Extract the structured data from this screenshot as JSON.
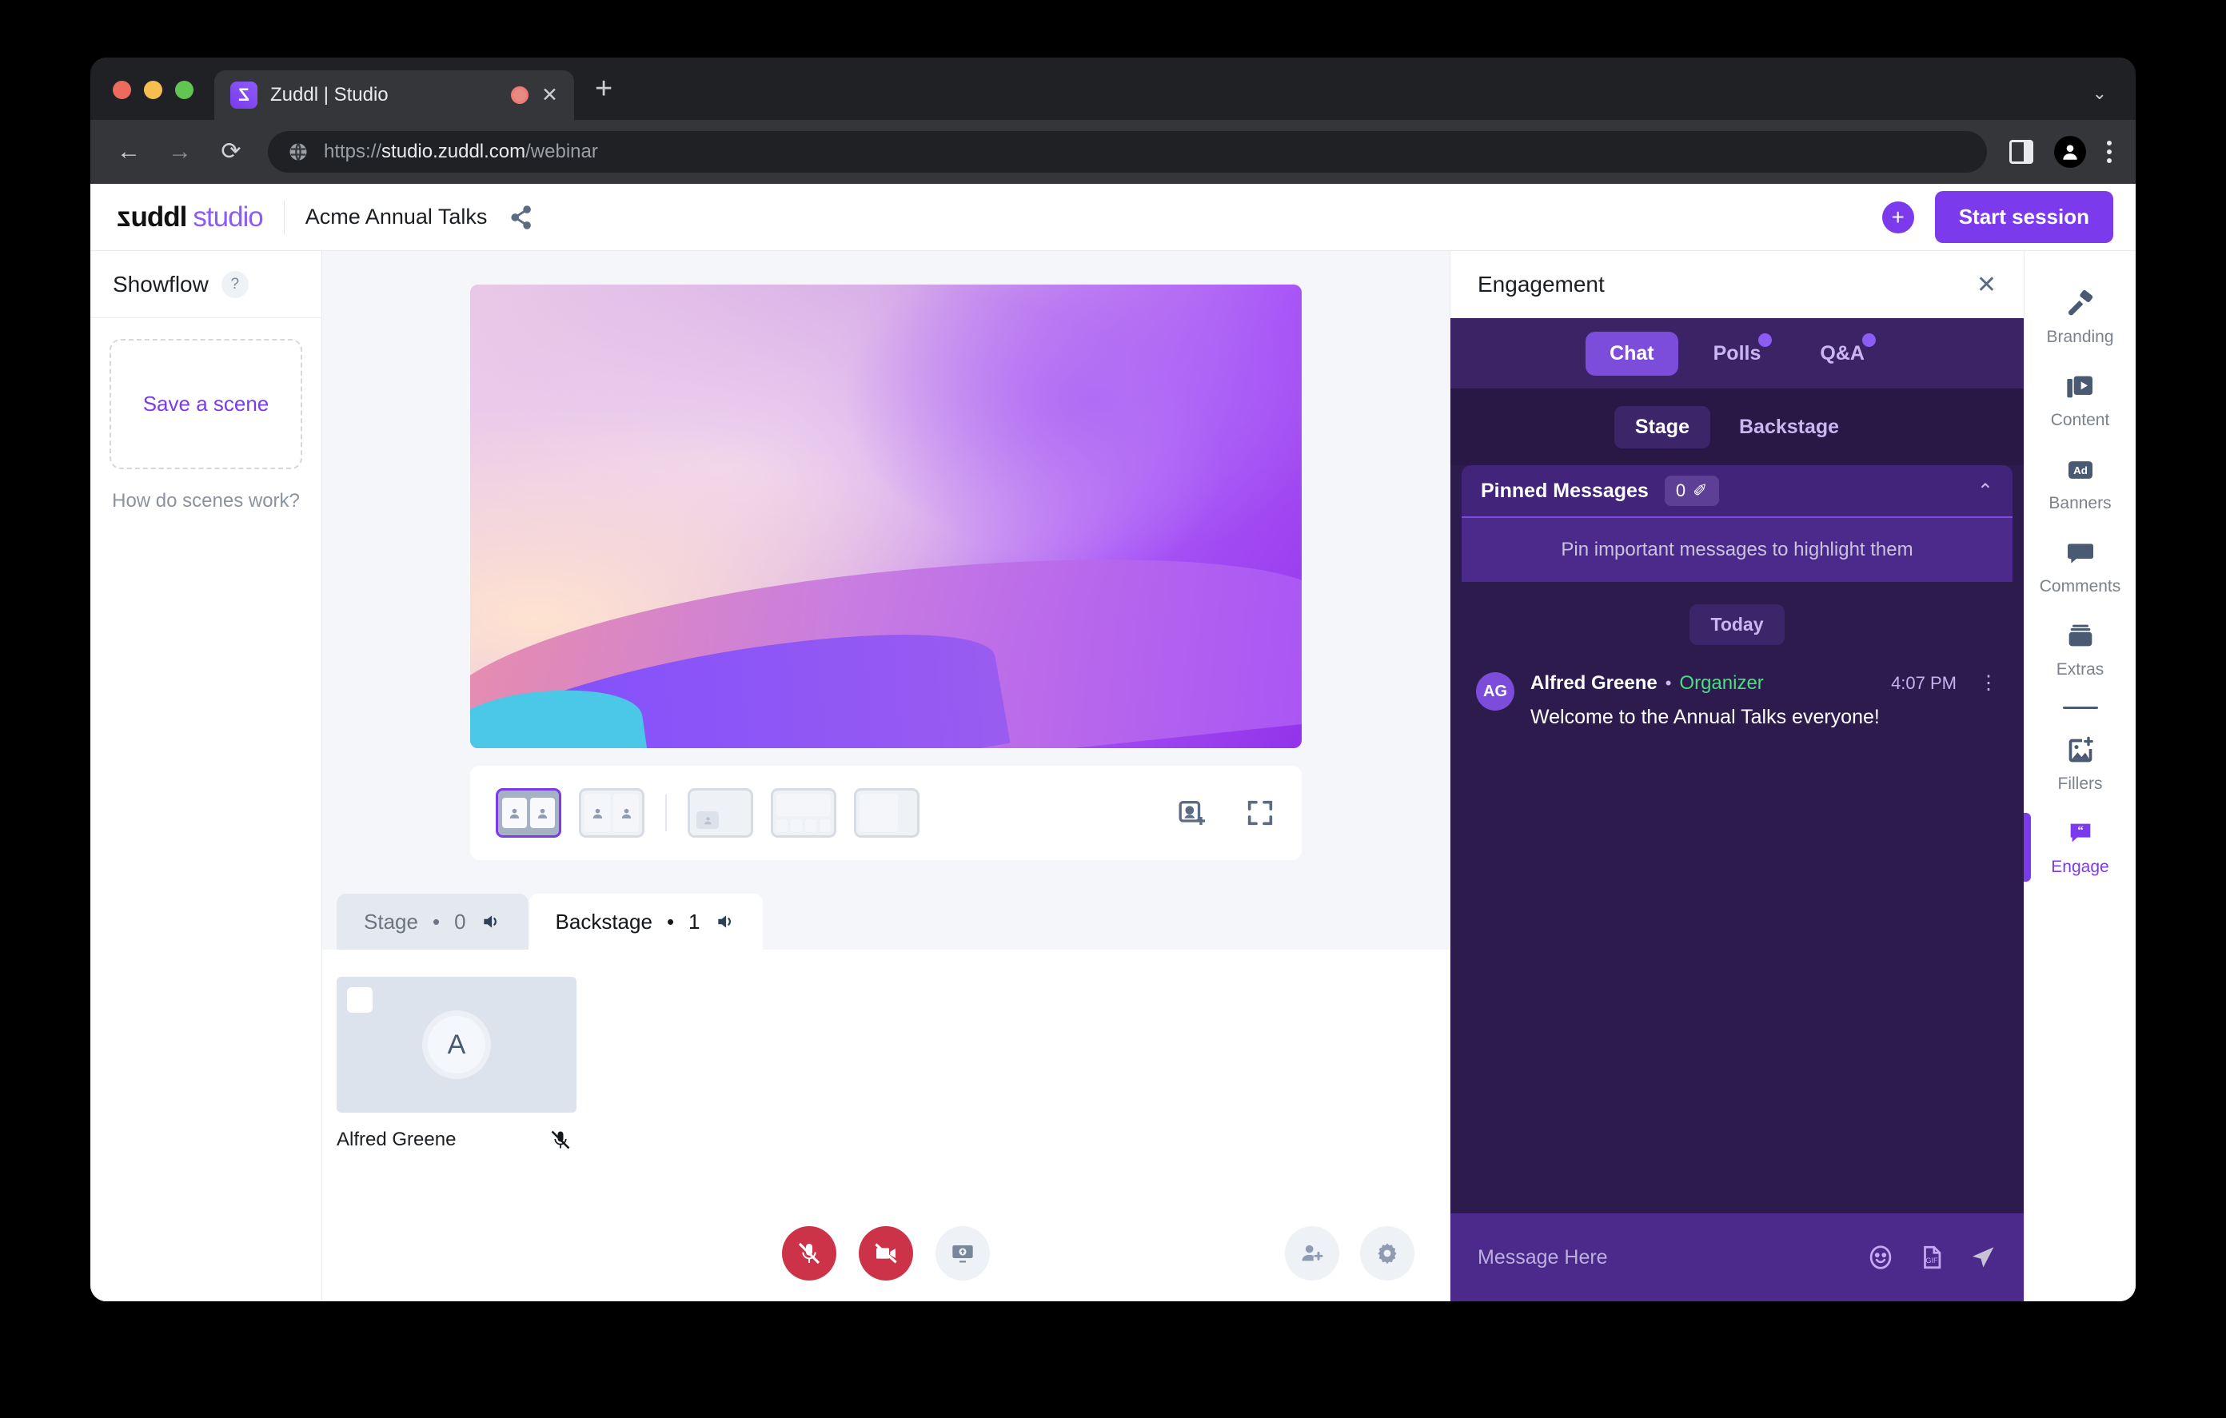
{
  "browser": {
    "tab_title": "Zuddl | Studio",
    "favicon_letter": "Z",
    "url_scheme": "https://",
    "url_main": "studio.zuddl.com",
    "url_path": "/webinar",
    "new_tab_label": "+",
    "tab_close_label": "✕",
    "tablist_chevron": "⌄",
    "back_label": "←",
    "forward_label": "→",
    "reload_label": "⟳"
  },
  "header": {
    "logo_z": "z",
    "logo_uddl": "uddl",
    "logo_studio": "studio",
    "event_name": "Acme Annual Talks",
    "add_button_label": "+",
    "start_session_label": "Start session"
  },
  "showflow": {
    "title": "Showflow",
    "help_badge": "?",
    "save_scene_label": "Save a scene",
    "how_scenes_work": "How do scenes work?"
  },
  "stage": {
    "layouts": [
      {
        "name": "layout-two-up-large",
        "selected": true
      },
      {
        "name": "layout-two-column",
        "selected": false
      },
      {
        "name": "layout-screenshare-pip",
        "selected": false
      },
      {
        "name": "layout-screenshare-strip-bottom",
        "selected": false
      },
      {
        "name": "layout-screenshare-strip-right",
        "selected": false
      }
    ],
    "add_to_stage_icon": "add-person-to-stage-icon",
    "fullscreen_icon": "fullscreen-icon"
  },
  "backstage": {
    "tabs": [
      {
        "label": "Stage",
        "count": "0",
        "separator": "•",
        "active": false
      },
      {
        "label": "Backstage",
        "count": "1",
        "separator": "•",
        "active": true
      }
    ],
    "participants": [
      {
        "name": "Alfred Greene",
        "initial": "A",
        "muted": true
      }
    ]
  },
  "controls": {
    "mic_label": "mic-off",
    "camera_label": "camera-off",
    "screenshare_label": "share-screen",
    "invite_label": "invite-people",
    "settings_label": "settings"
  },
  "engagement": {
    "title": "Engagement",
    "close_label": "✕",
    "tabs": [
      {
        "label": "Chat",
        "active": true,
        "dot": false
      },
      {
        "label": "Polls",
        "active": false,
        "dot": true
      },
      {
        "label": "Q&A",
        "active": false,
        "dot": true
      }
    ],
    "sub_tabs": [
      {
        "label": "Stage",
        "active": true
      },
      {
        "label": "Backstage",
        "active": false
      }
    ],
    "pinned": {
      "title": "Pinned Messages",
      "count": "0",
      "pin_icon": "✐",
      "collapse_icon": "⌃",
      "empty_text": "Pin important messages to highlight them"
    },
    "day_divider": "Today",
    "messages": [
      {
        "initials": "AG",
        "author": "Alfred Greene",
        "separator": "•",
        "role": "Organizer",
        "time": "4:07 PM",
        "text": "Welcome to the Annual Talks everyone!",
        "more_icon": "⋮"
      }
    ],
    "composer": {
      "placeholder": "Message Here",
      "emoji_icon": "emoji-icon",
      "gif_icon": "gif-icon",
      "gif_text": "GIF",
      "send_icon": "send-icon"
    }
  },
  "rail": {
    "items": [
      {
        "label": "Branding",
        "icon": "paint-roller-icon",
        "active": false
      },
      {
        "label": "Content",
        "icon": "video-library-icon",
        "active": false
      },
      {
        "label": "Banners",
        "icon": "ad-icon",
        "badge": "Ad",
        "active": false
      },
      {
        "label": "Comments",
        "icon": "speech-bubble-icon",
        "active": false
      },
      {
        "label": "Extras",
        "icon": "archive-box-icon",
        "active": false
      },
      {
        "label": "Fillers",
        "icon": "add-image-icon",
        "active": false
      },
      {
        "label": "Engage",
        "icon": "quote-bubble-icon",
        "active": true
      }
    ]
  },
  "colors": {
    "accent_purple": "#7C3AED",
    "panel_purple": "#2D1B4E",
    "danger_red": "#CC3348",
    "organizer_green": "#4ADE80"
  }
}
